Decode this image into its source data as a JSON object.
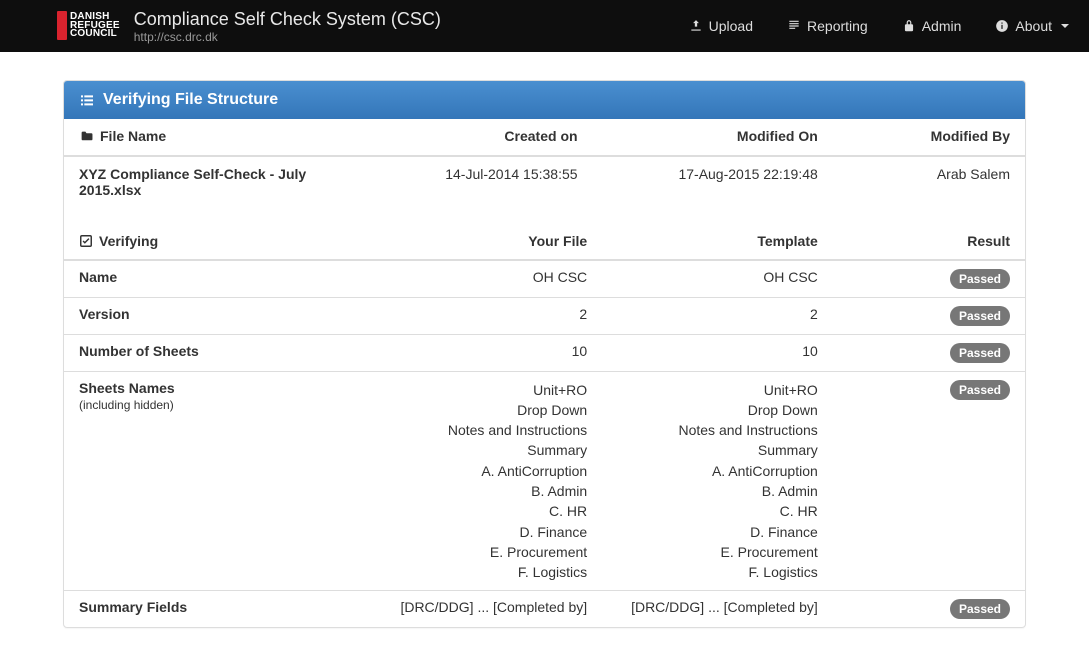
{
  "brand": {
    "logo_l1": "DANISH",
    "logo_l2": "REFUGEE",
    "logo_l3": "COUNCIL",
    "title": "Compliance Self Check System (CSC)",
    "url": "http://csc.drc.dk"
  },
  "nav": {
    "upload": "Upload",
    "reporting": "Reporting",
    "admin": "Admin",
    "about": "About"
  },
  "panel": {
    "title": "Verifying File Structure"
  },
  "meta": {
    "headers": {
      "file": "File Name",
      "created": "Created on",
      "modon": "Modified On",
      "modby": "Modified By"
    },
    "row": {
      "file": "XYZ Compliance Self-Check - July 2015.xlsx",
      "created": "14-Jul-2014 15:38:55",
      "modon": "17-Aug-2015 22:19:48",
      "modby": "Arab Salem"
    }
  },
  "verify": {
    "headers": {
      "label": "Verifying",
      "your": "Your File",
      "temp": "Template",
      "res": "Result"
    },
    "rows": {
      "name": {
        "label": "Name",
        "your": "OH CSC",
        "temp": "OH CSC",
        "res": "Passed"
      },
      "version": {
        "label": "Version",
        "your": "2",
        "temp": "2",
        "res": "Passed"
      },
      "sheets": {
        "label": "Number of Sheets",
        "your": "10",
        "temp": "10",
        "res": "Passed"
      },
      "names": {
        "label": "Sheets Names",
        "sub": "(including hidden)",
        "your": [
          "Unit+RO",
          "Drop Down",
          "Notes and Instructions",
          "Summary",
          "A. AntiCorruption",
          "B. Admin",
          "C. HR",
          "D. Finance",
          "E. Procurement",
          "F. Logistics"
        ],
        "temp": [
          "Unit+RO",
          "Drop Down",
          "Notes and Instructions",
          "Summary",
          "A. AntiCorruption",
          "B. Admin",
          "C. HR",
          "D. Finance",
          "E. Procurement",
          "F. Logistics"
        ],
        "res": "Passed"
      },
      "summary": {
        "label": "Summary Fields",
        "your": "[DRC/DDG] ... [Completed by]",
        "temp": "[DRC/DDG] ... [Completed by]",
        "res": "Passed"
      }
    }
  }
}
